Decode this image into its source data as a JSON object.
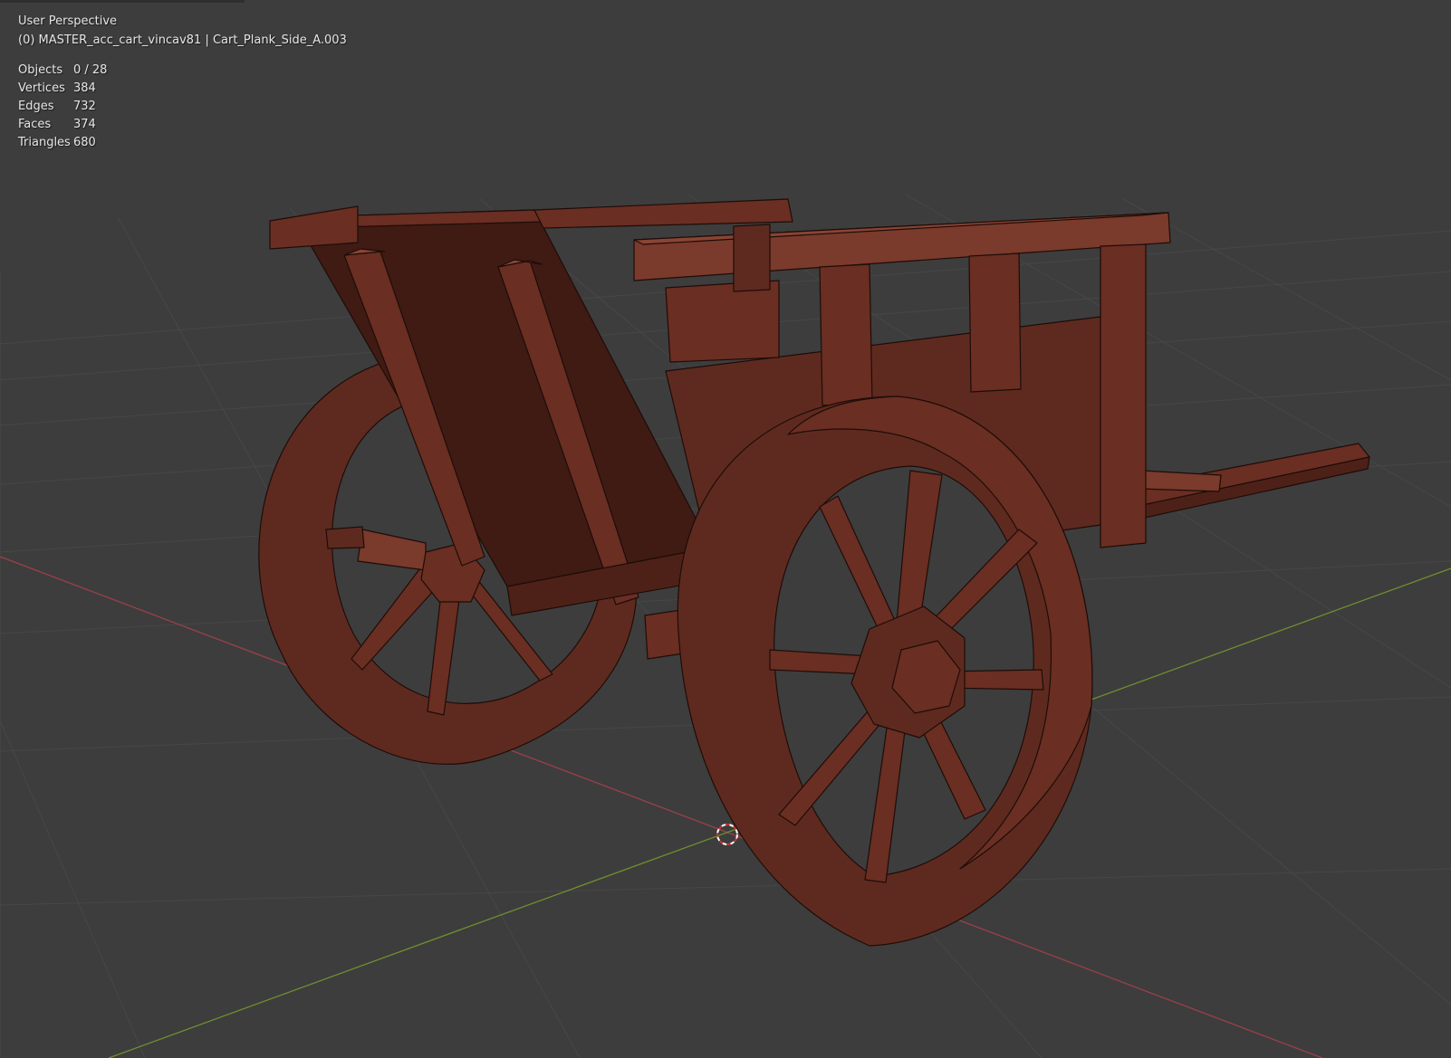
{
  "viewport": {
    "view_name": "User Perspective",
    "collection_object": "(0) MASTER_acc_cart_vincav81 | Cart_Plank_Side_A.003"
  },
  "stats": [
    {
      "label": "Objects",
      "value": "0 / 28"
    },
    {
      "label": "Vertices",
      "value": "384"
    },
    {
      "label": "Edges",
      "value": "732"
    },
    {
      "label": "Faces",
      "value": "374"
    },
    {
      "label": "Triangles",
      "value": "680"
    }
  ],
  "colors": {
    "background": "#3d3d3d",
    "grid": "#4a4a4a",
    "x_axis": "#9b4048",
    "y_axis": "#6d8f2e",
    "wood_light": "#7a3a2c",
    "wood_mid": "#5e2a1f",
    "wood_dark": "#3f1b14",
    "cursor": "#ffffff"
  },
  "icons": {
    "cursor": "3d-cursor-icon"
  }
}
